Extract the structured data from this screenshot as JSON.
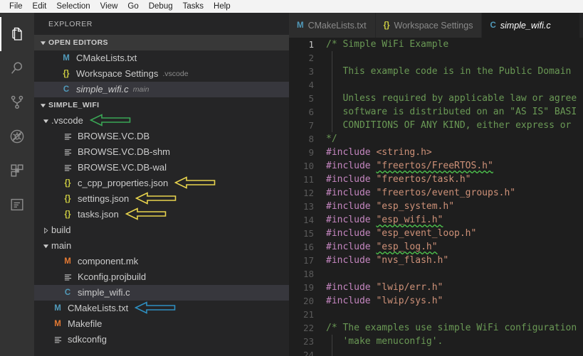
{
  "menubar": {
    "items": [
      "File",
      "Edit",
      "Selection",
      "View",
      "Go",
      "Debug",
      "Tasks",
      "Help"
    ]
  },
  "activitybar": {
    "items": [
      {
        "name": "explorer-icon",
        "label": "Explorer",
        "active": true
      },
      {
        "name": "search-icon",
        "label": "Search",
        "active": false
      },
      {
        "name": "source-control-icon",
        "label": "Source Control",
        "active": false
      },
      {
        "name": "debug-icon",
        "label": "Debug",
        "active": false
      },
      {
        "name": "extensions-icon",
        "label": "Extensions",
        "active": false
      },
      {
        "name": "output-panel-icon",
        "label": "Output",
        "active": false
      }
    ]
  },
  "sidebar": {
    "title": "EXPLORER",
    "open_editors": {
      "header": "OPEN EDITORS",
      "items": [
        {
          "icon": "m",
          "name": "CMakeLists.txt",
          "desc": "",
          "selected": false,
          "italic": false
        },
        {
          "icon": "json",
          "name": "Workspace Settings",
          "desc": ".vscode",
          "selected": false,
          "italic": false
        },
        {
          "icon": "c",
          "name": "simple_wifi.c",
          "desc": "main",
          "selected": true,
          "italic": true
        }
      ]
    },
    "project": {
      "header": "SIMPLE_WIFI",
      "items": [
        {
          "icon": "folder-open",
          "name": ".vscode",
          "indent": 1,
          "selected": false,
          "arrow": "green"
        },
        {
          "icon": "lines",
          "name": "BROWSE.VC.DB",
          "indent": 2,
          "selected": false,
          "arrow": ""
        },
        {
          "icon": "lines",
          "name": "BROWSE.VC.DB-shm",
          "indent": 2,
          "selected": false,
          "arrow": ""
        },
        {
          "icon": "lines",
          "name": "BROWSE.VC.DB-wal",
          "indent": 2,
          "selected": false,
          "arrow": ""
        },
        {
          "icon": "json",
          "name": "c_cpp_properties.json",
          "indent": 2,
          "selected": false,
          "arrow": "yellow"
        },
        {
          "icon": "json",
          "name": "settings.json",
          "indent": 2,
          "selected": false,
          "arrow": "yellow"
        },
        {
          "icon": "json",
          "name": "tasks.json",
          "indent": 2,
          "selected": false,
          "arrow": "yellow"
        },
        {
          "icon": "folder-closed",
          "name": "build",
          "indent": 1,
          "selected": false,
          "arrow": ""
        },
        {
          "icon": "folder-open",
          "name": "main",
          "indent": 1,
          "selected": false,
          "arrow": ""
        },
        {
          "icon": "m-orange",
          "name": "component.mk",
          "indent": 2,
          "selected": false,
          "arrow": ""
        },
        {
          "icon": "lines",
          "name": "Kconfig.projbuild",
          "indent": 2,
          "selected": false,
          "arrow": ""
        },
        {
          "icon": "c",
          "name": "simple_wifi.c",
          "indent": 2,
          "selected": true,
          "arrow": ""
        },
        {
          "icon": "m",
          "name": "CMakeLists.txt",
          "indent": 1,
          "selected": false,
          "arrow": "blue"
        },
        {
          "icon": "m-orange",
          "name": "Makefile",
          "indent": 1,
          "selected": false,
          "arrow": ""
        },
        {
          "icon": "lines",
          "name": "sdkconfig",
          "indent": 1,
          "selected": false,
          "arrow": ""
        }
      ]
    }
  },
  "annotations": {
    "green": "#3aa655",
    "yellow": "#e8d44d",
    "blue": "#2e8fc0"
  },
  "editor": {
    "tabs": [
      {
        "icon": "M",
        "icon_color": "#519aba",
        "label": "CMakeLists.txt",
        "active": false
      },
      {
        "icon": "{}",
        "icon_color": "#cbcb41",
        "label": "Workspace Settings",
        "active": false
      },
      {
        "icon": "C",
        "icon_color": "#519aba",
        "label": "simple_wifi.c",
        "active": true
      }
    ],
    "lines": [
      {
        "n": "1",
        "type": "comment",
        "text": "/* Simple WiFi Example"
      },
      {
        "n": "2",
        "type": "comment",
        "text": ""
      },
      {
        "n": "3",
        "type": "comment",
        "text": "   This example code is in the Public Domain "
      },
      {
        "n": "4",
        "type": "comment",
        "text": ""
      },
      {
        "n": "5",
        "type": "comment",
        "text": "   Unless required by applicable law or agree"
      },
      {
        "n": "6",
        "type": "comment",
        "text": "   software is distributed on an \"AS IS\" BASI"
      },
      {
        "n": "7",
        "type": "comment",
        "text": "   CONDITIONS OF ANY KIND, either express or "
      },
      {
        "n": "8",
        "type": "comment",
        "text": "*/"
      },
      {
        "n": "9",
        "type": "include",
        "directive": "#include",
        "target": "<string.h>",
        "squiggle": false
      },
      {
        "n": "10",
        "type": "include",
        "directive": "#include",
        "target": "\"freertos/FreeRTOS.h\"",
        "squiggle": true
      },
      {
        "n": "11",
        "type": "include",
        "directive": "#include",
        "target": "\"freertos/task.h\"",
        "squiggle": false
      },
      {
        "n": "12",
        "type": "include",
        "directive": "#include",
        "target": "\"freertos/event_groups.h\"",
        "squiggle": false
      },
      {
        "n": "13",
        "type": "include",
        "directive": "#include",
        "target": "\"esp_system.h\"",
        "squiggle": false
      },
      {
        "n": "14",
        "type": "include",
        "directive": "#include",
        "target": "\"esp_wifi.h\"",
        "squiggle": true
      },
      {
        "n": "15",
        "type": "include",
        "directive": "#include",
        "target": "\"esp_event_loop.h\"",
        "squiggle": false
      },
      {
        "n": "16",
        "type": "include",
        "directive": "#include",
        "target": "\"esp_log.h\"",
        "squiggle": true
      },
      {
        "n": "17",
        "type": "include",
        "directive": "#include",
        "target": "\"nvs_flash.h\"",
        "squiggle": false
      },
      {
        "n": "18",
        "type": "blank",
        "text": ""
      },
      {
        "n": "19",
        "type": "include",
        "directive": "#include",
        "target": "\"lwip/err.h\"",
        "squiggle": false
      },
      {
        "n": "20",
        "type": "include",
        "directive": "#include",
        "target": "\"lwip/sys.h\"",
        "squiggle": false
      },
      {
        "n": "21",
        "type": "blank",
        "text": ""
      },
      {
        "n": "22",
        "type": "comment",
        "text": "/* The examples use simple WiFi configuration"
      },
      {
        "n": "23",
        "type": "comment",
        "text": "   'make menuconfig'."
      },
      {
        "n": "24",
        "type": "blank",
        "text": ""
      }
    ]
  }
}
